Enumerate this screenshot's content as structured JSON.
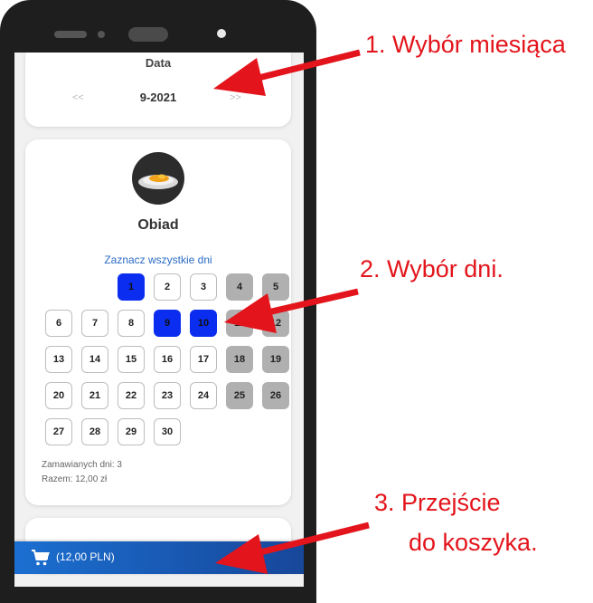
{
  "date_picker": {
    "title": "Data",
    "prev_label": "<<",
    "value": "9-2021",
    "next_label": ">>"
  },
  "meal": {
    "title": "Obiad",
    "select_all_label": "Zaznacz wszystkie dni",
    "days": [
      {
        "label": "1",
        "state": "selected"
      },
      {
        "label": "2",
        "state": "available"
      },
      {
        "label": "3",
        "state": "available"
      },
      {
        "label": "4",
        "state": "weekend"
      },
      {
        "label": "5",
        "state": "weekend"
      },
      {
        "label": "6",
        "state": "available"
      },
      {
        "label": "7",
        "state": "available"
      },
      {
        "label": "8",
        "state": "available"
      },
      {
        "label": "9",
        "state": "selected"
      },
      {
        "label": "10",
        "state": "selected"
      },
      {
        "label": "11",
        "state": "weekend"
      },
      {
        "label": "12",
        "state": "weekend"
      },
      {
        "label": "13",
        "state": "available"
      },
      {
        "label": "14",
        "state": "available"
      },
      {
        "label": "15",
        "state": "available"
      },
      {
        "label": "16",
        "state": "available"
      },
      {
        "label": "17",
        "state": "available"
      },
      {
        "label": "18",
        "state": "weekend"
      },
      {
        "label": "19",
        "state": "weekend"
      },
      {
        "label": "20",
        "state": "available"
      },
      {
        "label": "21",
        "state": "available"
      },
      {
        "label": "22",
        "state": "available"
      },
      {
        "label": "23",
        "state": "available"
      },
      {
        "label": "24",
        "state": "available"
      },
      {
        "label": "25",
        "state": "weekend"
      },
      {
        "label": "26",
        "state": "weekend"
      },
      {
        "label": "27",
        "state": "available"
      },
      {
        "label": "28",
        "state": "available"
      },
      {
        "label": "29",
        "state": "available"
      },
      {
        "label": "30",
        "state": "available"
      }
    ],
    "summary_days": "Zamawianych dni: 3",
    "summary_total": "Razem: 12,00 zł"
  },
  "cart": {
    "label": "(12,00 PLN)",
    "icon": "shopping-cart-icon"
  },
  "annotations": {
    "step1": "1. Wybór miesiąca",
    "step2": "2. Wybór dni.",
    "step3_line1": "3. Przejście",
    "step3_line2": "do koszyka."
  },
  "colors": {
    "selected_day": "#0a2df0",
    "weekend_day": "#b0b0b0",
    "annotation": "#e3141b",
    "cart_bar": "#1b5fbf"
  }
}
